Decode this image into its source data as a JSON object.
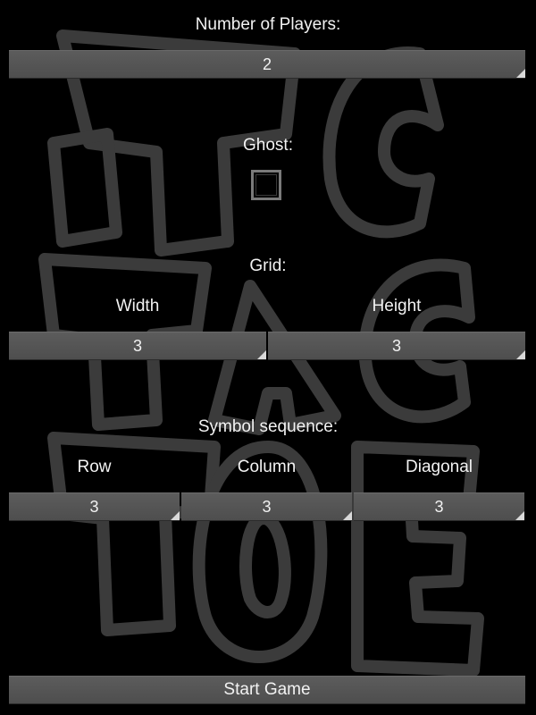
{
  "players": {
    "label": "Number of Players:",
    "value": "2"
  },
  "ghost": {
    "label": "Ghost:",
    "checked": false
  },
  "grid": {
    "label": "Grid:",
    "width_label": "Width",
    "width_value": "3",
    "height_label": "Height",
    "height_value": "3"
  },
  "sequence": {
    "label": "Symbol sequence:",
    "row_label": "Row",
    "row_value": "3",
    "column_label": "Column",
    "column_value": "3",
    "diagonal_label": "Diagonal",
    "diagonal_value": "3"
  },
  "start_button": "Start Game",
  "background_graphic": "tic-tac-toe-graffiti-logo",
  "colors": {
    "background": "#000000",
    "field": "#555555",
    "text": "#f2f2f2",
    "logo_outline": "#3d3d3d"
  }
}
